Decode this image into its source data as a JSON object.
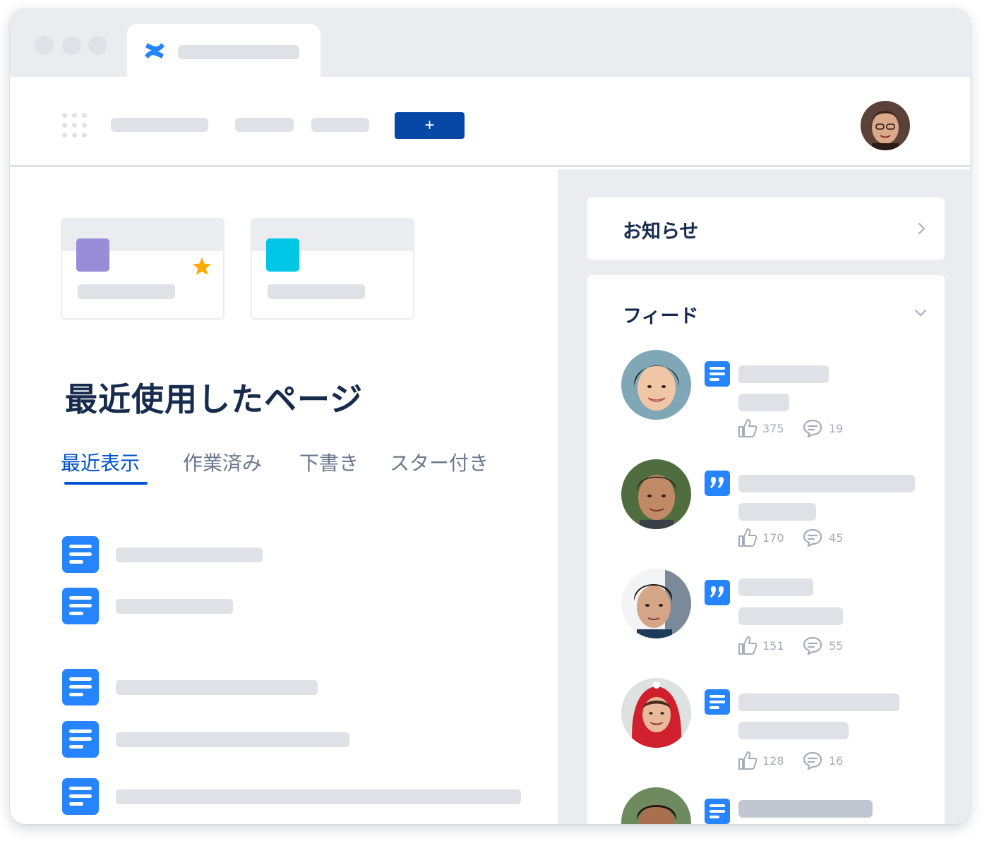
{
  "browser": {
    "tab_icon": "confluence-logo-icon"
  },
  "nav": {
    "apps_icon": "app-grid-icon",
    "create_label": "+",
    "avatar": "user-avatar"
  },
  "cards": [
    {
      "color": "#998dd9",
      "starred": true
    },
    {
      "color": "#00c7e6",
      "starred": false
    }
  ],
  "main": {
    "title": "最近使用したページ",
    "tabs": [
      {
        "label": "最近表示",
        "active": true
      },
      {
        "label": "作業済み",
        "active": false
      },
      {
        "label": "下書き",
        "active": false
      },
      {
        "label": "スター付き",
        "active": false
      }
    ],
    "doc_icon": "document-icon"
  },
  "sidebar": {
    "announcements": {
      "title": "お知らせ",
      "icon": "chevron-right-icon"
    },
    "feed": {
      "title": "フィード",
      "icon": "chevron-down-icon",
      "items": [
        {
          "type": "document-icon",
          "likes": "375",
          "comments": "19"
        },
        {
          "type": "quote-icon",
          "likes": "170",
          "comments": "45"
        },
        {
          "type": "quote-icon",
          "likes": "151",
          "comments": "55"
        },
        {
          "type": "document-icon",
          "likes": "128",
          "comments": "16"
        },
        {
          "type": "document-icon"
        }
      ]
    }
  },
  "colors": {
    "primary": "#0747a6",
    "link": "#0052cc",
    "icon_blue": "#2684ff",
    "star": "#ffab00",
    "text": "#172b4d",
    "muted": "#6b778c",
    "placeholder": "#dfe1e6",
    "surface": "#ebecf0"
  }
}
